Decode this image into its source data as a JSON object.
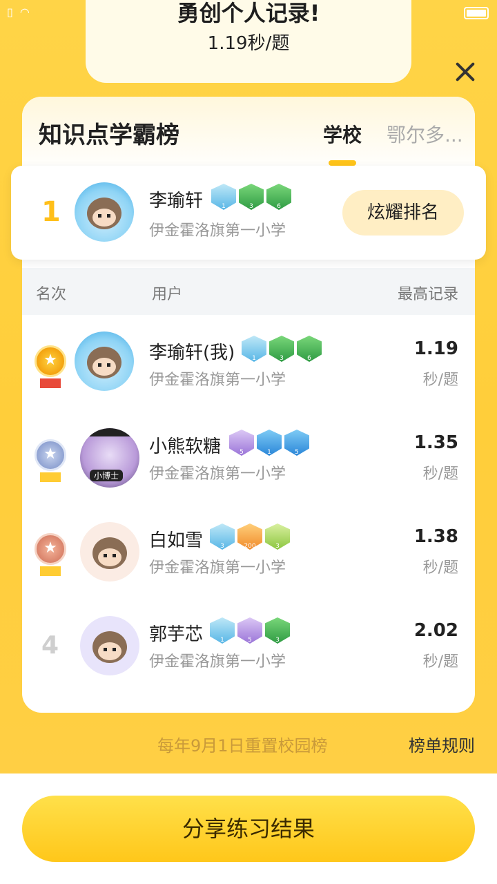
{
  "record": {
    "title": "勇创个人记录!",
    "value": "1.19秒/题"
  },
  "panel": {
    "title": "知识点学霸榜",
    "tabs": [
      "学校",
      "鄂尔多..."
    ]
  },
  "my_entry": {
    "rank": "1",
    "name": "李瑜轩",
    "school": "伊金霍洛旗第一小学",
    "button": "炫耀排名"
  },
  "columns": {
    "rank": "名次",
    "user": "用户",
    "record": "最高记录"
  },
  "rows": [
    {
      "rank": "1",
      "name": "李瑜轩(我)",
      "school": "伊金霍洛旗第一小学",
      "score": "1.19",
      "unit": "秒/题"
    },
    {
      "rank": "2",
      "name": "小熊软糖",
      "school": "伊金霍洛旗第一小学",
      "score": "1.35",
      "unit": "秒/题",
      "avatar_label": "小博士"
    },
    {
      "rank": "3",
      "name": "白如雪",
      "school": "伊金霍洛旗第一小学",
      "score": "1.38",
      "unit": "秒/题"
    },
    {
      "rank": "4",
      "name": "郭芋芯",
      "school": "伊金霍洛旗第一小学",
      "score": "2.02",
      "unit": "秒/题"
    }
  ],
  "badges": {
    "my_entry": [
      {
        "label": "1"
      },
      {
        "label": "3"
      },
      {
        "label": "6"
      }
    ],
    "row1": [
      {
        "label": "1"
      },
      {
        "label": "3"
      },
      {
        "label": "6"
      }
    ],
    "row2": [
      {
        "label": "5"
      },
      {
        "label": "1"
      },
      {
        "label": "5"
      }
    ],
    "row3": [
      {
        "label": "3"
      },
      {
        "label": "200"
      },
      {
        "label": "3"
      }
    ],
    "row4": [
      {
        "label": "1"
      },
      {
        "label": "5"
      },
      {
        "label": "3"
      }
    ]
  },
  "footer": {
    "reset_note": "每年9月1日重置校园榜",
    "rules": "榜单规则"
  },
  "share_button": "分享练习结果",
  "colors": {
    "accent": "#ffc41a",
    "background": "#ffd447",
    "rank_gold": "#ffbf1a"
  }
}
